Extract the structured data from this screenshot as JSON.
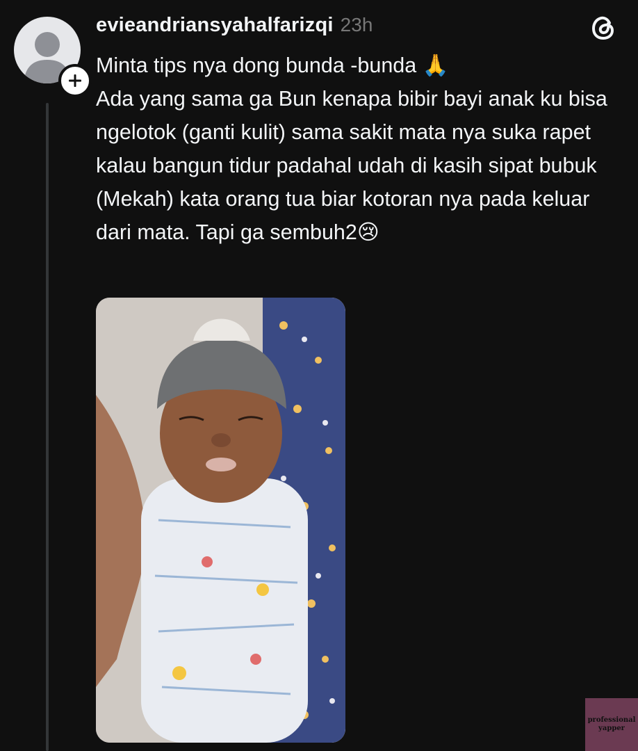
{
  "post": {
    "username": "evieandriansyahalfarizqi",
    "timestamp": "23h",
    "body_lines": [
      "Minta tips nya dong bunda -bunda 🙏",
      "Ada yang sama ga Bun kenapa bibir bayi anak ku bisa ngelotok (ganti kulit) sama sakit mata nya suka rapet kalau bangun tidur padahal udah di kasih sipat bubuk (Mekah) kata orang tua biar kotoran nya pada keluar dari mata. Tapi ga sembuh2😢"
    ]
  },
  "icons": {
    "avatar": "default-avatar-icon",
    "follow": "plus-icon",
    "app": "threads-logo-icon"
  },
  "colors": {
    "background": "#101010",
    "text": "#f3f5f7",
    "muted": "#777777",
    "thread_line": "#333638"
  },
  "watermark": {
    "line1": "professional",
    "line2": "yapper"
  }
}
